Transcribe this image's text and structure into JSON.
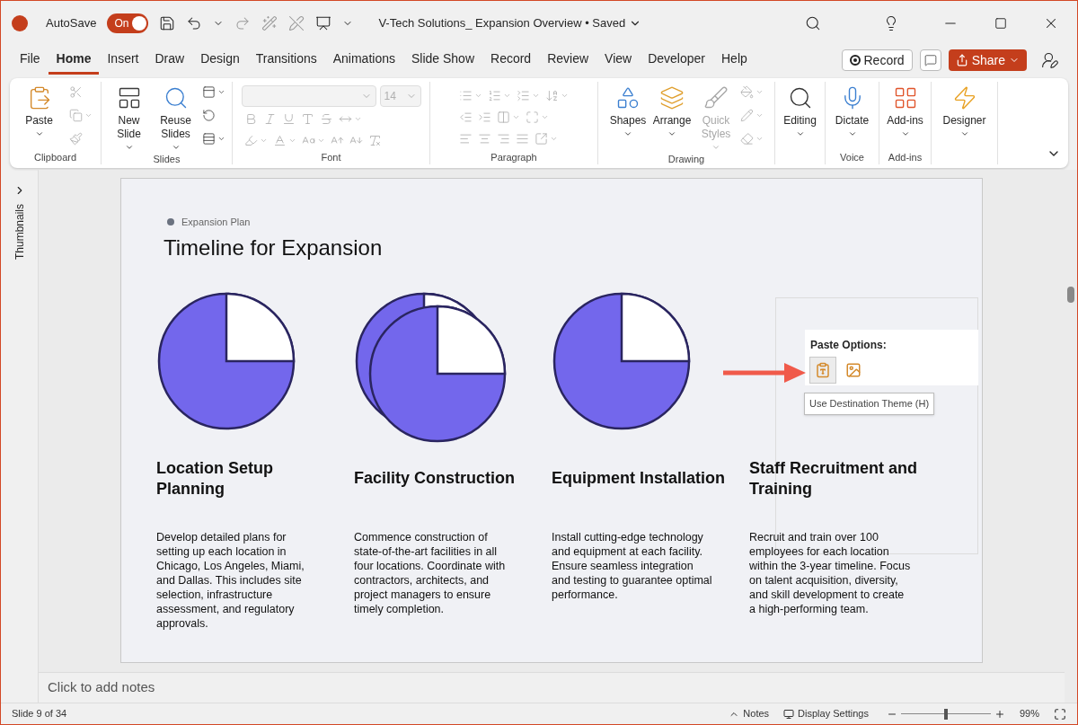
{
  "title_bar": {
    "autosave_label": "AutoSave",
    "autosave": {
      "label": "On",
      "on": true
    },
    "document_title": "V-Tech Solutions_ Expansion Overview • Saved"
  },
  "menu_tabs": [
    {
      "label": "File",
      "selected": false
    },
    {
      "label": "Home",
      "selected": true
    },
    {
      "label": "Insert",
      "selected": false
    },
    {
      "label": "Draw",
      "selected": false
    },
    {
      "label": "Design",
      "selected": false
    },
    {
      "label": "Transitions",
      "selected": false
    },
    {
      "label": "Animations",
      "selected": false
    },
    {
      "label": "Slide Show",
      "selected": false
    },
    {
      "label": "Record",
      "selected": false
    },
    {
      "label": "Review",
      "selected": false
    },
    {
      "label": "View",
      "selected": false
    },
    {
      "label": "Developer",
      "selected": false
    },
    {
      "label": "Help",
      "selected": false
    }
  ],
  "header_buttons": {
    "record": "Record",
    "share": "Share"
  },
  "ribbon": [
    {
      "kind": "clipboard",
      "name": "Clipboard",
      "tools_disabled": true,
      "buttons": [
        {
          "label": "Paste",
          "disabled": false
        }
      ]
    },
    {
      "kind": "slides",
      "name": "Slides",
      "tools_disabled": false,
      "buttons": [
        {
          "label": "New Slide",
          "disabled": false
        },
        {
          "label": "Reuse Slides",
          "disabled": false
        }
      ]
    },
    {
      "kind": "font",
      "name": "Font",
      "tools_disabled": true,
      "font_size": "14"
    },
    {
      "kind": "paragraph",
      "name": "Paragraph",
      "tools_disabled": true
    },
    {
      "kind": "drawing",
      "name": "Drawing",
      "tools_disabled": true,
      "buttons": [
        {
          "label": "Shapes",
          "disabled": false
        },
        {
          "label": "Arrange",
          "disabled": false
        },
        {
          "label": "Quick Styles",
          "disabled": true
        }
      ]
    },
    {
      "kind": "editing",
      "buttons": [
        {
          "label": "Editing",
          "disabled": false
        }
      ]
    },
    {
      "kind": "voice",
      "name": "Voice",
      "buttons": [
        {
          "label": "Dictate",
          "disabled": false
        }
      ]
    },
    {
      "kind": "addins",
      "name": "Add-ins",
      "buttons": [
        {
          "label": "Add-ins",
          "disabled": false
        }
      ]
    },
    {
      "kind": "designer",
      "buttons": [
        {
          "label": "Designer",
          "disabled": false
        }
      ]
    }
  ],
  "thumbnails_label": "Thumbnails",
  "slide": {
    "label": "Expansion Plan",
    "title": "Timeline for Expansion",
    "columns": [
      {
        "heading": "Location Setup Planning",
        "body": "Develop detailed plans for setting up each location in Chicago, Los Angeles, Miami, and Dallas. This includes site selection, infrastructure assessment, and regulatory approvals.",
        "kind": "single"
      },
      {
        "heading": "Facility Construction",
        "body": "Commence construction of state-of-the-art facilities in all four locations. Coordinate with contractors, architects, and project managers to ensure timely completion.",
        "kind": "stacked"
      },
      {
        "heading": "Equipment Installation",
        "body": "Install cutting-edge technology and equipment at each facility. Ensure seamless integration and testing to guarantee optimal performance.",
        "kind": "single"
      },
      {
        "heading": "Staff Recruitment and Training",
        "body": "Recruit and train over 100 employees for each location within the 3-year timeline. Focus on talent acquisition, diversity, and skill development to create a high-performing team.",
        "kind": "blank"
      }
    ]
  },
  "paste_options": {
    "title": "Paste Options:",
    "options": [
      {
        "kind": "theme",
        "selected": true
      },
      {
        "kind": "picture",
        "selected": false
      }
    ],
    "tooltip": "Use Destination Theme (H)"
  },
  "notes_placeholder": "Click to add notes",
  "status_bar": {
    "slide": "Slide 9 of 34",
    "notes": "Notes",
    "display": "Display Settings",
    "zoom": {
      "level": 0.5
    },
    "zoom_value": "99%"
  }
}
